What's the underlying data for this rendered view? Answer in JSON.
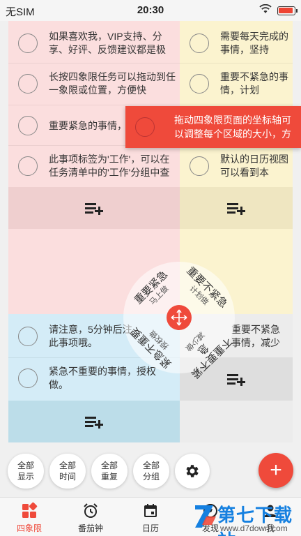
{
  "status_bar": {
    "carrier": "无SIM",
    "time": "20:30"
  },
  "quadrants": {
    "important_urgent": {
      "color": "#fbdede",
      "tasks": [
        "如果喜欢我，VIP支持、分享、好评、反馈建议都是极",
        "长按四象限任务可以拖动到任一象限或位置，方便快",
        "重要紧急的事情，",
        "此事项标签为'工作'，可以在任务清单中的'工作'分组中查"
      ]
    },
    "important_not_urgent": {
      "color": "#fbf3cf",
      "tasks": [
        "需要每天完成的事情，坚持",
        "重要不紧急的事情，计划",
        "",
        "默认的日历视图可以看到本"
      ]
    },
    "urgent_not_important": {
      "color": "#d4ecf7",
      "tasks": [
        "请注意，5分钟后注此事项哦。",
        "紧急不重要的事情，授权做。"
      ]
    },
    "not_urgent_not_important": {
      "color": "#ececec",
      "tasks": [
        "重要不紧急事情，减少"
      ]
    }
  },
  "tooltip": {
    "text": "拖动四象限页面的坐标轴可以调整每个区域的大小，方",
    "color": "#ef4a3b"
  },
  "wheel": {
    "top_left": {
      "title": "重要紧急",
      "sub": "马上做"
    },
    "top_right": {
      "title": "重要不紧急",
      "sub": "计划做"
    },
    "bottom_left": {
      "title": "紧急不重要",
      "sub": "授权做"
    },
    "bottom_right": {
      "title": "不重要不紧急",
      "sub": "减少做"
    }
  },
  "filters": [
    {
      "line1": "全部",
      "line2": "显示"
    },
    {
      "line1": "全部",
      "line2": "时间"
    },
    {
      "line1": "全部",
      "line2": "重复"
    },
    {
      "line1": "全部",
      "line2": "分组"
    }
  ],
  "fab_label": "+",
  "tabs": [
    {
      "label": "四象限",
      "icon": "four-quadrant-icon",
      "active": true
    },
    {
      "label": "番茄钟",
      "icon": "alarm-clock-icon",
      "active": false
    },
    {
      "label": "日历",
      "icon": "calendar-icon",
      "active": false
    },
    {
      "label": "发现",
      "icon": "discover-icon",
      "active": false
    },
    {
      "label": "我",
      "icon": "profile-icon",
      "active": false
    }
  ],
  "watermark": {
    "brand": "第七下载站",
    "url": "www.d7down.com"
  },
  "colors": {
    "accent": "#ef4a3b"
  }
}
